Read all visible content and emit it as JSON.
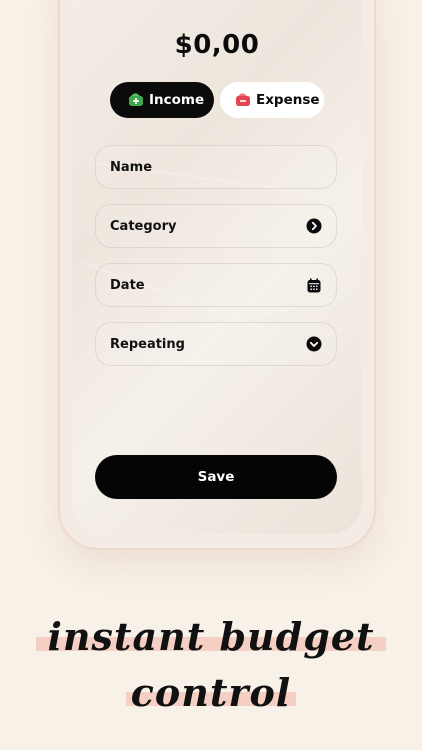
{
  "amount": "$0,00",
  "toggles": {
    "income_label": "Income",
    "expense_label": "Expense",
    "selected": "Income"
  },
  "fields": {
    "name_label": "Name",
    "category_label": "Category",
    "date_label": "Date",
    "repeating_label": "Repeating"
  },
  "save_label": "Save",
  "tagline": {
    "line1": "instant budget",
    "line2": "control"
  },
  "colors": {
    "background": "#f8f1e8",
    "accent_dark": "#050505",
    "income_icon": "#3fa64a",
    "expense_icon": "#e2454f",
    "highlight": "#f6cfc4"
  },
  "icons": {
    "income": "wallet-income-icon",
    "expense": "wallet-expense-icon",
    "category": "chevron-right-circle-icon",
    "date": "calendar-icon",
    "repeating": "chevron-down-circle-icon"
  }
}
